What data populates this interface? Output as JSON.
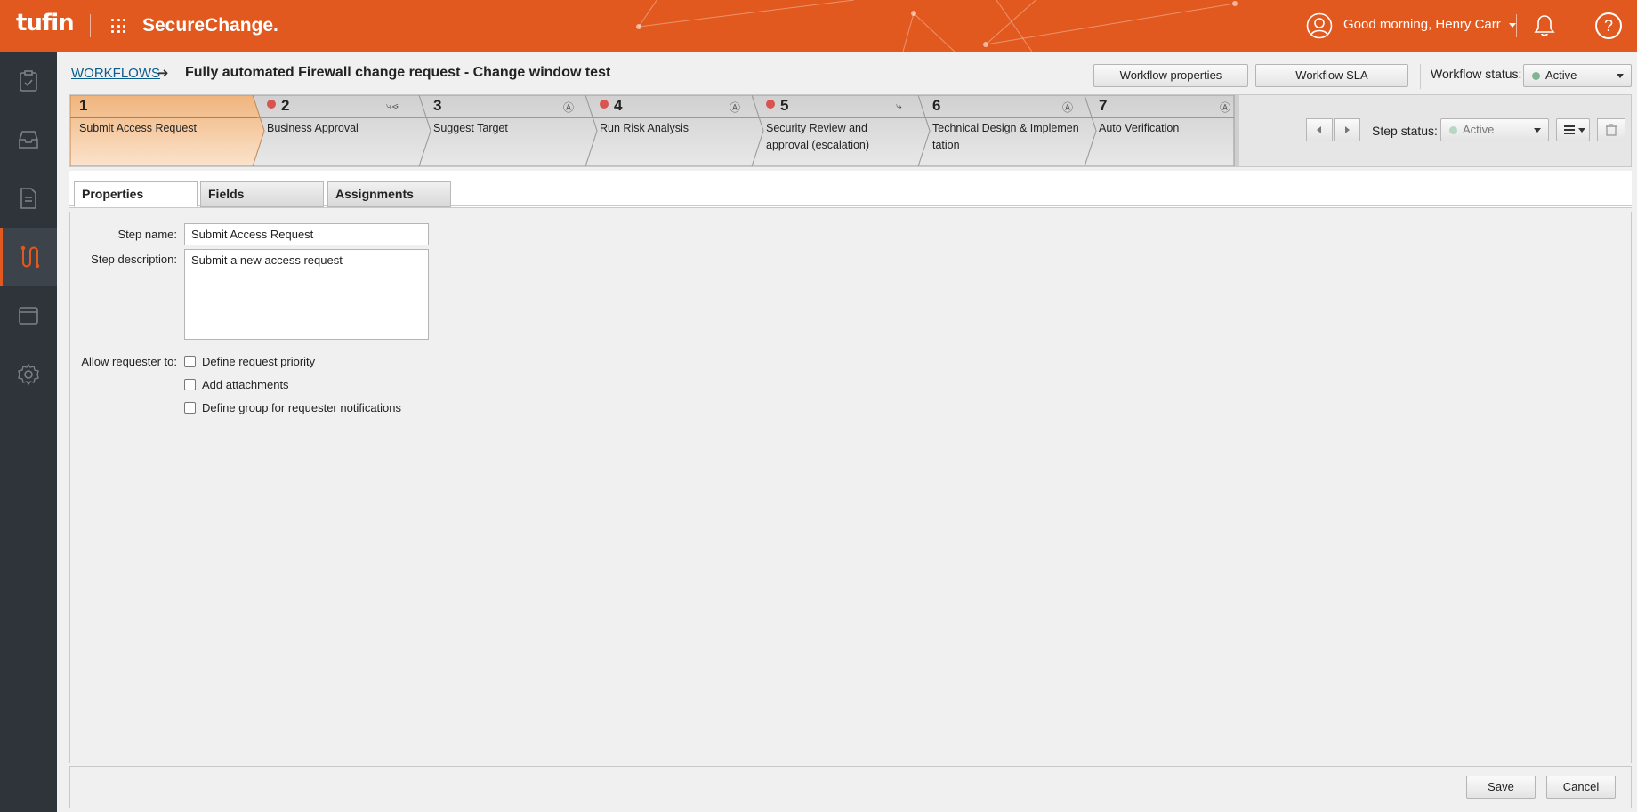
{
  "header": {
    "logo": "tufin",
    "product": "SecureChange.",
    "greeting": "Good morning, Henry Carr",
    "help": "?"
  },
  "sidebar": {
    "items": [
      {
        "icon": "clipboard-check-icon"
      },
      {
        "icon": "inbox-icon"
      },
      {
        "icon": "document-icon"
      },
      {
        "icon": "workflow-icon",
        "active": true
      },
      {
        "icon": "browser-window-icon"
      },
      {
        "icon": "gear-icon"
      }
    ]
  },
  "page": {
    "breadcrumb": "WORKFLOWS",
    "arrow": "➜",
    "title": "Fully automated Firewall change request - Change window test",
    "workflow_properties": "Workflow properties",
    "workflow_sla": "Workflow SLA",
    "workflow_status_label": "Workflow status:",
    "workflow_status": "Active"
  },
  "steps": [
    {
      "num": "1",
      "label": "Submit Access Request",
      "dot": false,
      "icon": ""
    },
    {
      "num": "2",
      "label": "Business Approval",
      "dot": true,
      "icon": "⤷⋖"
    },
    {
      "num": "3",
      "label": "Suggest Target",
      "dot": false,
      "icon": "Ⓐ"
    },
    {
      "num": "4",
      "label": "Run Risk Analysis",
      "dot": true,
      "icon": "Ⓐ"
    },
    {
      "num": "5",
      "label": "Security Review and approval (escalation)",
      "dot": true,
      "icon": "⤷"
    },
    {
      "num": "6",
      "label": "Technical Design & Implementation",
      "dot": false,
      "icon": "Ⓐ"
    },
    {
      "num": "7",
      "label": "Auto Verification",
      "dot": false,
      "icon": "Ⓐ"
    }
  ],
  "step_status": {
    "label": "Step status:",
    "value": "Active"
  },
  "tabs": [
    "Properties",
    "Fields",
    "Assignments"
  ],
  "form": {
    "step_name_label": "Step name:",
    "step_name": "Submit Access Request",
    "step_description_label": "Step description:",
    "step_description": "Submit a new access request",
    "allow_label": "Allow requester to:",
    "options": [
      "Define request priority",
      "Add attachments",
      "Define group for requester notifications"
    ]
  },
  "footer": {
    "save": "Save",
    "cancel": "Cancel"
  },
  "colors": {
    "brand": "#e2591f",
    "sidebar": "#2e3439",
    "active_step": "#f5c9a0",
    "status_dot": "#7fb593",
    "step_dot": "#d9534f"
  }
}
